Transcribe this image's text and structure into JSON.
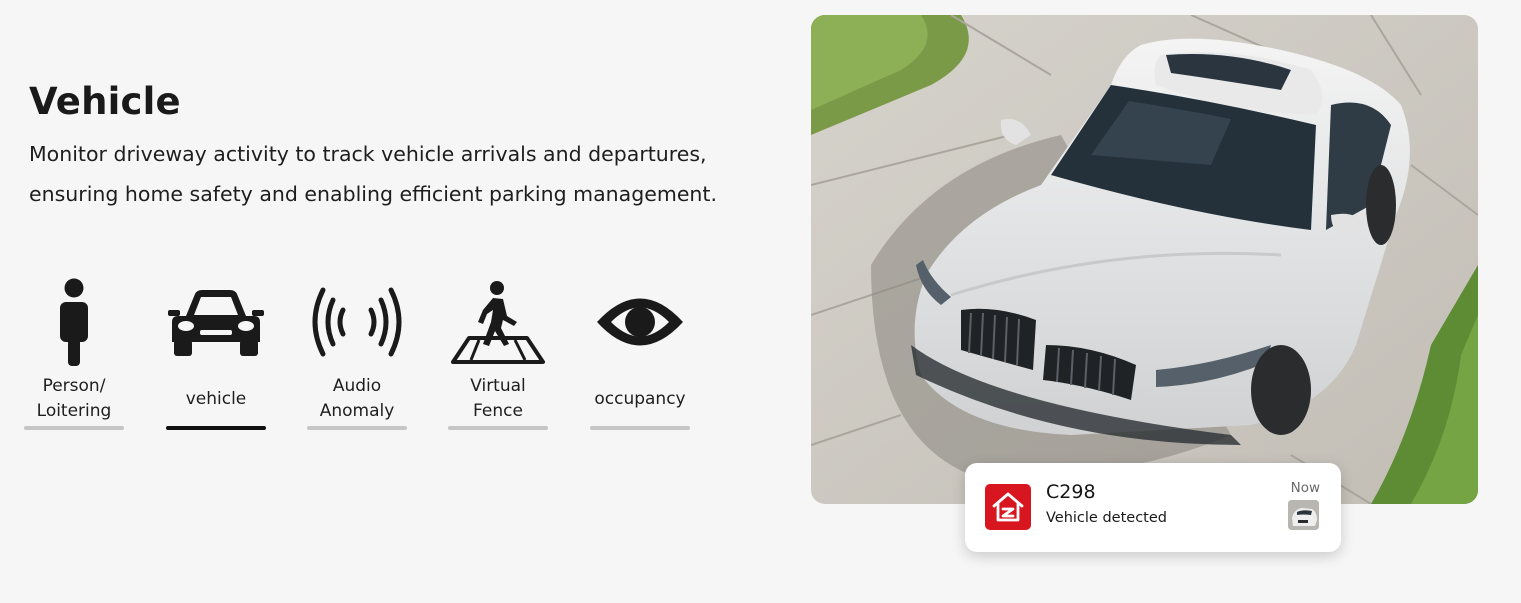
{
  "section": {
    "title": "Vehicle",
    "description": "Monitor driveway activity to track vehicle arrivals and departures, ensuring home safety and enabling efficient parking management."
  },
  "tabs": [
    {
      "label": "Person/\nLoitering",
      "icon": "person-icon",
      "active": false
    },
    {
      "label": "vehicle",
      "icon": "car-icon",
      "active": true
    },
    {
      "label": "Audio\nAnomaly",
      "icon": "audio-waves-icon",
      "active": false
    },
    {
      "label": "Virtual\nFence",
      "icon": "pedestrian-crossing-icon",
      "active": false
    },
    {
      "label": "occupancy",
      "icon": "eye-icon",
      "active": false
    }
  ],
  "notification": {
    "title": "C298",
    "message": "Vehicle detected",
    "time": "Now",
    "app_icon": "home-app-icon",
    "thumbnail": "car-thumbnail"
  },
  "colors": {
    "background": "#f6f6f6",
    "text": "#1c1c1c",
    "active_underline": "#111111",
    "inactive_underline": "#c6c6c6",
    "app_icon_red": "#d8161f"
  }
}
